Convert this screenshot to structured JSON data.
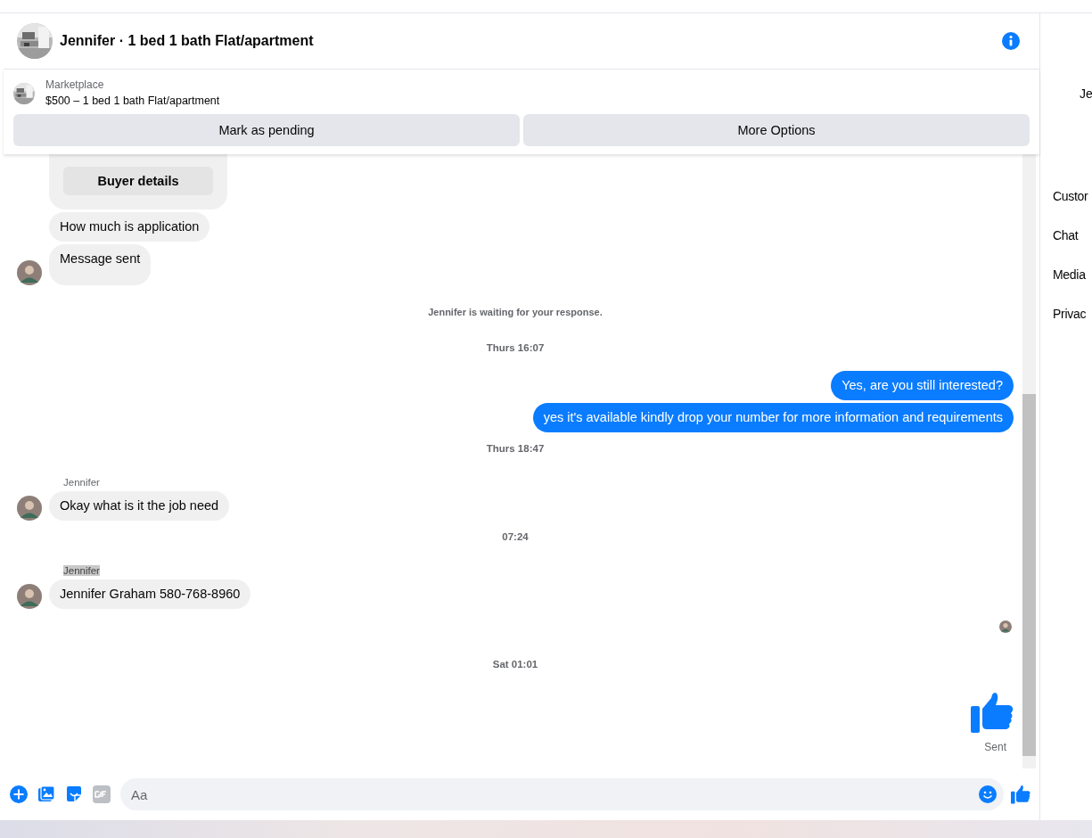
{
  "header": {
    "title": "Jennifer · 1 bed 1 bath Flat/apartment"
  },
  "listing": {
    "source": "Marketplace",
    "title": "$500 – 1 bed 1 bath Flat/apartment",
    "actions": [
      "Mark as pending",
      "More Options"
    ]
  },
  "messages": [
    {
      "kind": "card",
      "button": "Buyer details"
    },
    {
      "kind": "in",
      "text": "How much is application",
      "avatar": false
    },
    {
      "kind": "in",
      "text": "Message sent",
      "avatar": true,
      "tall": true
    },
    {
      "kind": "note",
      "text": "Jennifer is waiting for your response."
    },
    {
      "kind": "time",
      "text": "Thurs 16:07"
    },
    {
      "kind": "out",
      "text": "Yes, are you still interested?"
    },
    {
      "kind": "out",
      "text": "yes it's available kindly drop your number for more information and requirements"
    },
    {
      "kind": "time",
      "text": "Thurs 18:47"
    },
    {
      "kind": "in",
      "sender": "Jennifer",
      "highlighted": false,
      "text": "Okay what is it the job need",
      "avatar": true
    },
    {
      "kind": "time",
      "text": "07:24"
    },
    {
      "kind": "in",
      "sender": "Jennifer",
      "highlighted": true,
      "text": "Jennifer Graham 580-768-8960",
      "avatar": true
    },
    {
      "kind": "seen"
    },
    {
      "kind": "time",
      "text": "Sat 01:01"
    },
    {
      "kind": "like",
      "status": "Sent"
    }
  ],
  "composer": {
    "placeholder": "Aa"
  },
  "side_panel": {
    "name": "Je",
    "items": [
      "Custor",
      "Chat",
      "Media",
      "Privac"
    ]
  }
}
